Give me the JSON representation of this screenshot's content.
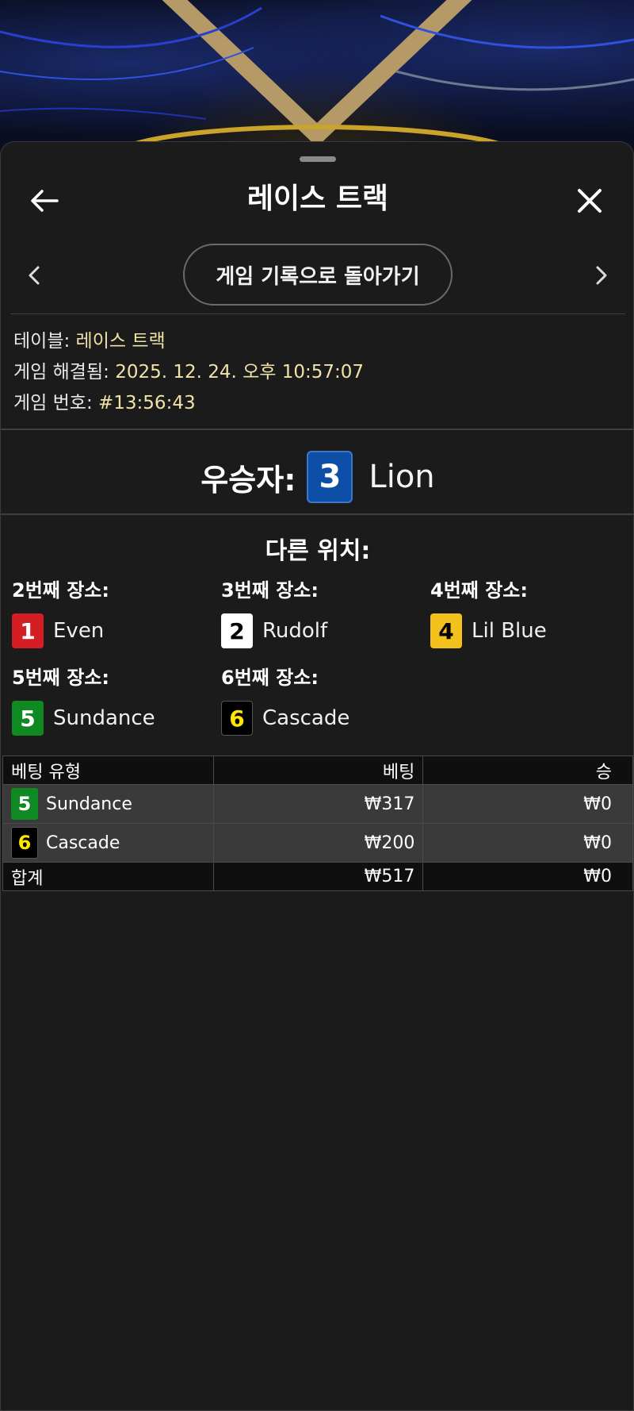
{
  "header": {
    "title": "레이스 트랙"
  },
  "nav": {
    "back_to_history_label": "게임 기록으로 돌아가기"
  },
  "info": {
    "table_label": "테이블:",
    "table_value": "레이스 트랙",
    "resolved_label": "게임 해결됨:",
    "resolved_value": "2025. 12. 24. 오후 10:57:07",
    "game_no_label": "게임 번호:",
    "game_no_value": "#13:56:43"
  },
  "winner": {
    "label": "우승자:",
    "number": "3",
    "name": "Lion",
    "badge_color": "#0d4ea6"
  },
  "other_positions": {
    "title": "다른 위치:",
    "places": [
      {
        "label": "2번째 장소:",
        "number": "1",
        "name": "Even",
        "bg": "#d51e24",
        "fg": "#ffffff"
      },
      {
        "label": "3번째 장소:",
        "number": "2",
        "name": "Rudolf",
        "bg": "#ffffff",
        "fg": "#000000"
      },
      {
        "label": "4번째 장소:",
        "number": "4",
        "name": "Lil Blue",
        "bg": "#f3c11c",
        "fg": "#000000"
      },
      {
        "label": "5번째 장소:",
        "number": "5",
        "name": "Sundance",
        "bg": "#0f8a22",
        "fg": "#ffffff"
      },
      {
        "label": "6번째 장소:",
        "number": "6",
        "name": "Cascade",
        "bg": "#000000",
        "fg": "#ffe600"
      }
    ]
  },
  "bets_table": {
    "headers": [
      "베팅 유형",
      "베팅",
      "승"
    ],
    "rows": [
      {
        "number": "5",
        "name": "Sundance",
        "bet": "₩317",
        "win": "₩0",
        "bg": "#0f8a22",
        "fg": "#ffffff"
      },
      {
        "number": "6",
        "name": "Cascade",
        "bet": "₩200",
        "win": "₩0",
        "bg": "#000000",
        "fg": "#ffe600"
      }
    ],
    "total": {
      "label": "합계",
      "bet": "₩517",
      "win": "₩0"
    }
  },
  "icons": {
    "back": "arrow-left-icon",
    "close": "close-icon",
    "prev": "chevron-left-icon",
    "next": "chevron-right-icon"
  }
}
